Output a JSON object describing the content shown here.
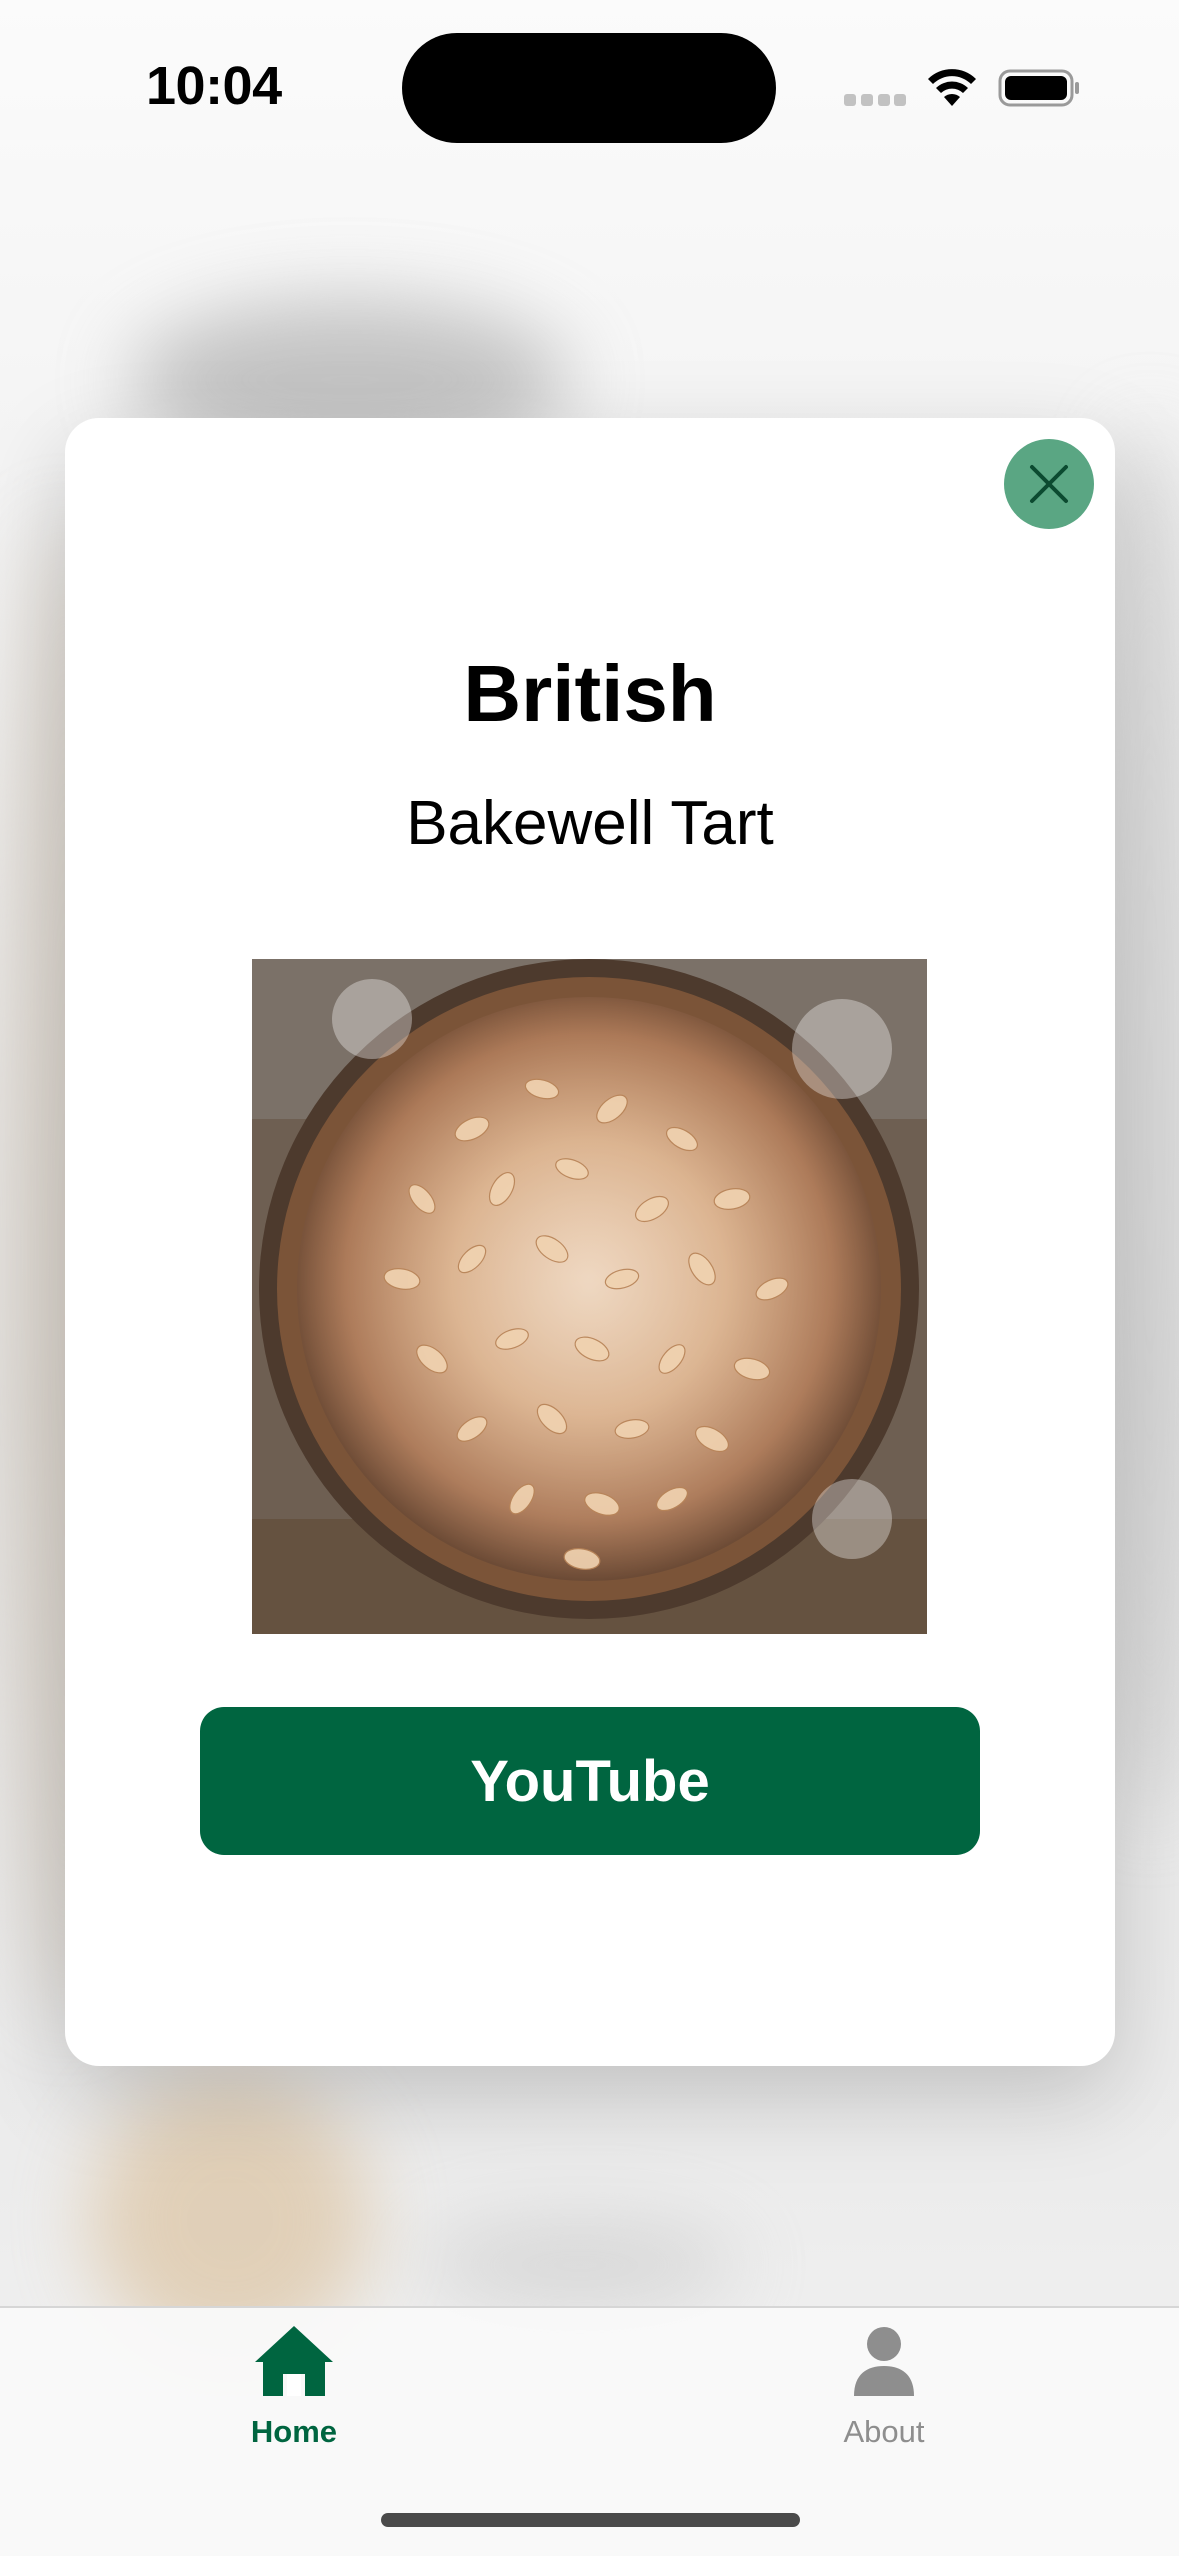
{
  "status_bar": {
    "time": "10:04"
  },
  "modal": {
    "cuisine": "British",
    "meal_name": "Bakewell Tart",
    "youtube_label": "YouTube",
    "accent_color": "#006540",
    "close_color": "#5aa683"
  },
  "tab_bar": {
    "tabs": [
      {
        "label": "Home",
        "icon": "house-icon",
        "selected": true
      },
      {
        "label": "About",
        "icon": "person-icon",
        "selected": false
      }
    ]
  }
}
